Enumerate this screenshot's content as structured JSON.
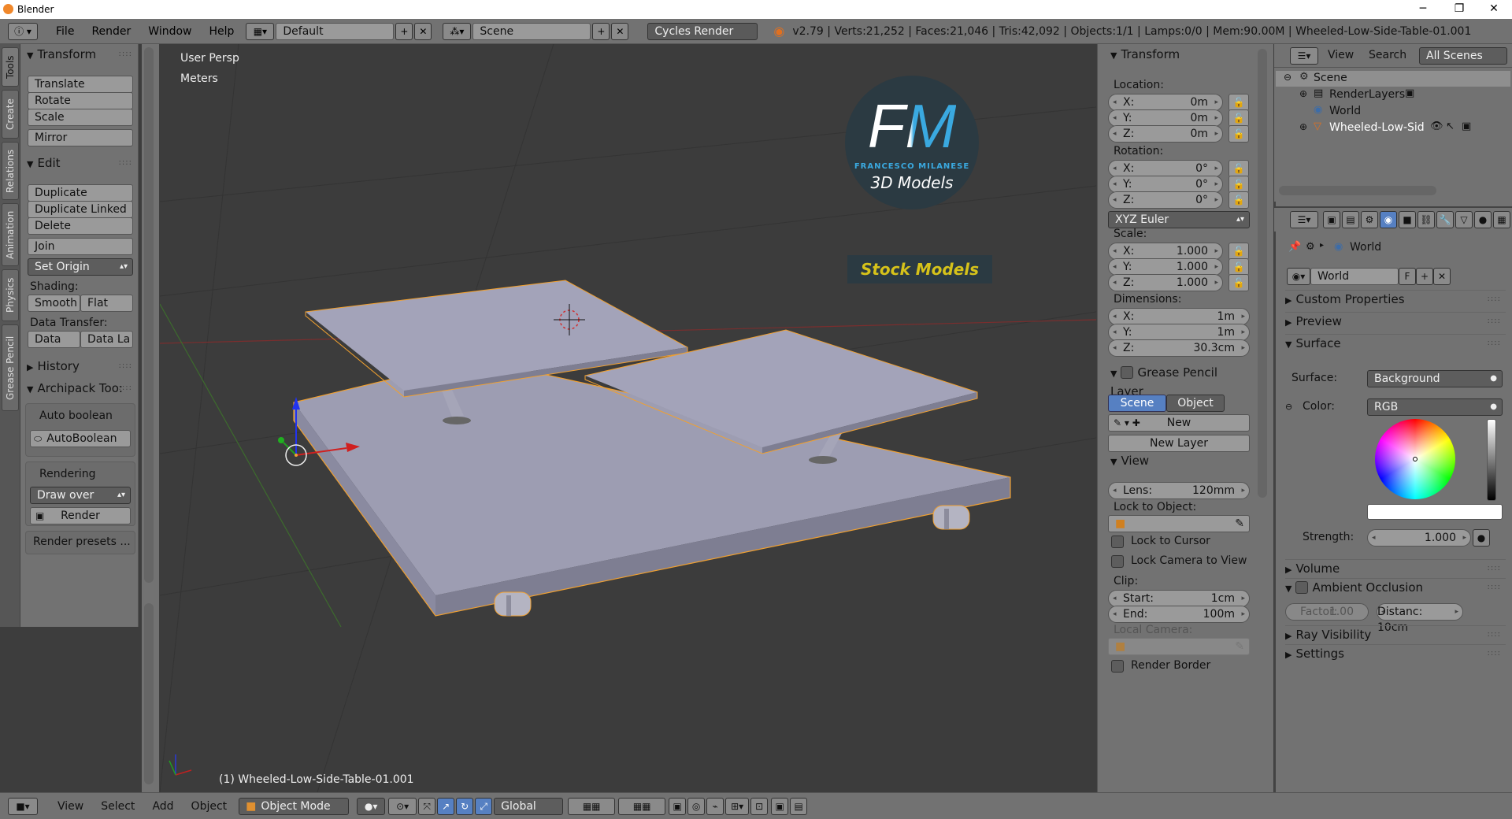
{
  "window": {
    "title": "Blender",
    "controls": [
      "─",
      "❐",
      "✕"
    ]
  },
  "header": {
    "menus": [
      "File",
      "Render",
      "Window",
      "Help"
    ],
    "layout": "Default",
    "scene": "Scene",
    "engine": "Cycles Render",
    "stats": "v2.79 | Verts:21,252 | Faces:21,046 | Tris:42,092 | Objects:1/1 | Lamps:0/0 | Mem:90.00M | Wheeled-Low-Side-Table-01.001"
  },
  "side_tabs": [
    "Tools",
    "Create",
    "Relations",
    "Animation",
    "Physics",
    "Grease Pencil"
  ],
  "toolshelf": {
    "transform": {
      "title": "Transform",
      "buttons": [
        "Translate",
        "Rotate",
        "Scale",
        "Mirror"
      ]
    },
    "edit": {
      "title": "Edit",
      "buttons": [
        "Duplicate",
        "Duplicate Linked",
        "Delete",
        "Join"
      ],
      "set_origin": "Set Origin"
    },
    "shading": {
      "label": "Shading:",
      "smooth": "Smooth",
      "flat": "Flat"
    },
    "data_transfer": {
      "label": "Data Transfer:",
      "data": "Data",
      "data_la": "Data La"
    },
    "history": "History",
    "archipack": {
      "title": "Archipack Too:",
      "auto_boolean_label": "Auto boolean",
      "auto_boolean_btn": "AutoBoolean",
      "rendering_label": "Rendering",
      "draw_over": "Draw over",
      "render": "Render",
      "render_presets": "Render presets ..."
    }
  },
  "viewport": {
    "view_name": "User Persp",
    "units": "Meters",
    "object_label": "(1) Wheeled-Low-Side-Table-01.001",
    "watermark": {
      "fm": "FM",
      "author": "FRANCESCO MILANESE",
      "sub": "3D Models",
      "stock": "Stock Models"
    }
  },
  "npanel": {
    "transform_title": "Transform",
    "location": {
      "label": "Location:",
      "x": "0m",
      "y": "0m",
      "z": "0m"
    },
    "rotation": {
      "label": "Rotation:",
      "x": "0°",
      "y": "0°",
      "z": "0°",
      "mode": "XYZ Euler"
    },
    "scale": {
      "label": "Scale:",
      "x": "1.000",
      "y": "1.000",
      "z": "1.000"
    },
    "dimensions": {
      "label": "Dimensions:",
      "x": "1m",
      "y": "1m",
      "z": "30.3cm"
    },
    "axis": {
      "x": "X:",
      "y": "Y:",
      "z": "Z:"
    },
    "grease": {
      "title": "Grease Pencil Layer",
      "scene": "Scene",
      "object": "Object",
      "new": "New",
      "new_layer": "New Layer"
    },
    "view": {
      "title": "View",
      "lens_label": "Lens:",
      "lens": "120mm",
      "lock_to_object": "Lock to Object:",
      "lock_cursor": "Lock to Cursor",
      "lock_camera": "Lock Camera to View",
      "clip": "Clip:",
      "start_label": "Start:",
      "start": "1cm",
      "end_label": "End:",
      "end": "100m",
      "local_camera": "Local Camera:",
      "render_border": "Render Border"
    }
  },
  "outliner": {
    "menus": [
      "View",
      "Search"
    ],
    "filter": "All Scenes",
    "items": [
      "Scene",
      "RenderLayers",
      "World",
      "Wheeled-Low-Side-Tab"
    ]
  },
  "properties": {
    "breadcrumb": "World",
    "world_name": "World",
    "fake_user": "F",
    "panels": {
      "custom_props": "Custom Properties",
      "preview": "Preview",
      "surface": "Surface",
      "volume": "Volume",
      "ao": "Ambient Occlusion",
      "ray_vis": "Ray Visibility",
      "settings": "Settings"
    },
    "surface_label": "Surface:",
    "surface_value": "Background",
    "color_label": "Color:",
    "color_value": "RGB",
    "strength_label": "Strength:",
    "strength": "1.000",
    "factor_label": "Factor:",
    "factor": "1.00",
    "distance": "Distanc: 10cm"
  },
  "footer": {
    "menus": [
      "View",
      "Select",
      "Add",
      "Object"
    ],
    "mode": "Object Mode",
    "orientation": "Global"
  },
  "colors": {
    "panel": "#727272",
    "viewport": "#3c3c3c",
    "accent_blue": "#5680c2",
    "selection_orange": "#f0a030"
  }
}
